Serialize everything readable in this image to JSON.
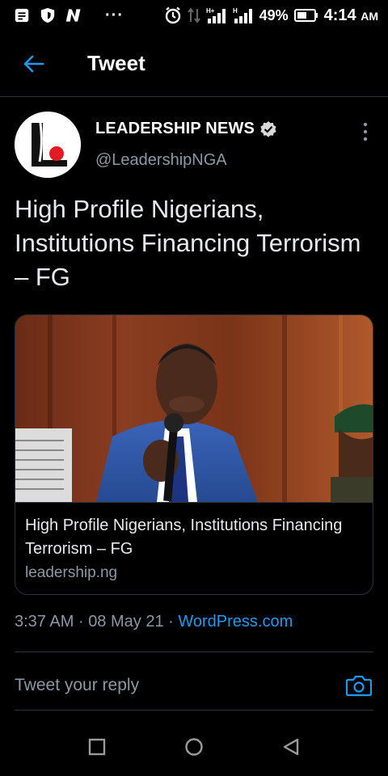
{
  "status_bar": {
    "icons": [
      "notes-icon",
      "shield-icon",
      "n-app-icon"
    ],
    "more": "···",
    "battery_percent": "49%",
    "time": "4:14",
    "ampm": "AM"
  },
  "header": {
    "title": "Tweet"
  },
  "tweet": {
    "author_name": "LEADERSHIP NEWS",
    "handle": "@LeadershipNGA",
    "text": "High Profile Nigerians, Institutions Financing Terrorism – FG",
    "card": {
      "title": "High Profile Nigerians, Institutions Financing Terrorism – FG",
      "domain": "leadership.ng"
    },
    "time": "3:37 AM",
    "date": "08 May 21",
    "source": "WordPress.com",
    "separator": "·"
  },
  "reply": {
    "placeholder": "Tweet your reply"
  },
  "colors": {
    "accent": "#1d9bf0",
    "secondary_text": "#8b98a5",
    "divider": "#2f3336",
    "background": "#000000"
  }
}
